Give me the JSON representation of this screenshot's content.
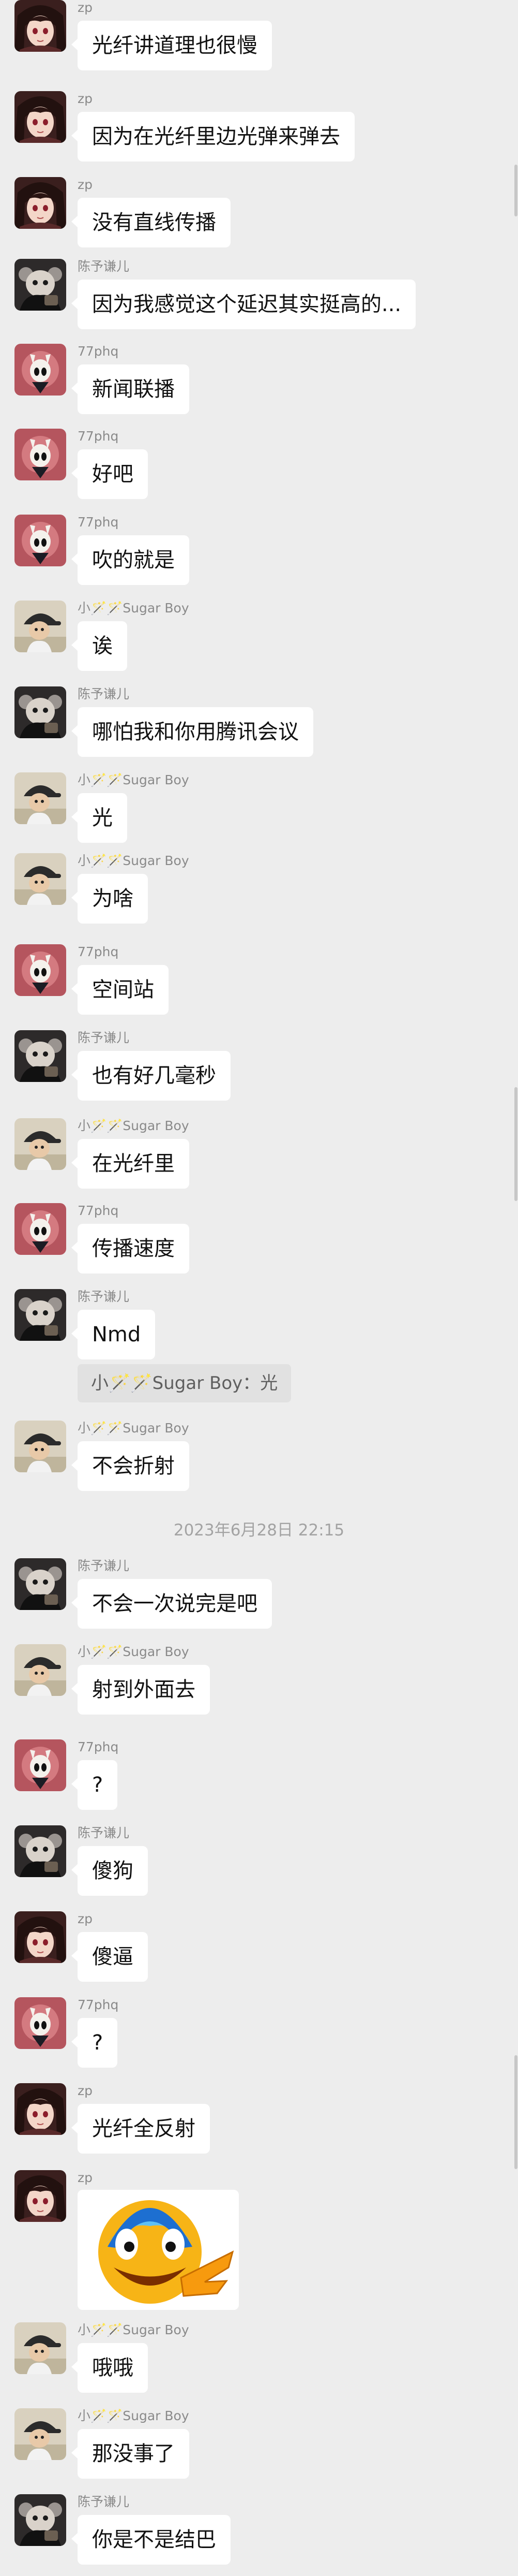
{
  "timestamp": "2023年6月28日 22:15",
  "quote": "小🪄🪄Sugar Boy：光",
  "messages": [
    {
      "sender": "zp",
      "text": "光纤讲道理也很慢"
    },
    {
      "sender": "zp",
      "text": "因为在光纤里边光弹来弹去"
    },
    {
      "sender": "zp",
      "text": "没有直线传播"
    },
    {
      "sender": "陈予谦儿",
      "text": "因为我感觉这个延迟其实挺高的..."
    },
    {
      "sender": "77phq",
      "text": "新闻联播"
    },
    {
      "sender": "77phq",
      "text": "好吧"
    },
    {
      "sender": "77phq",
      "text": "吹的就是"
    },
    {
      "sender": "小🪄🪄Sugar Boy",
      "text": "诶"
    },
    {
      "sender": "陈予谦儿",
      "text": "哪怕我和你用腾讯会议"
    },
    {
      "sender": "小🪄🪄Sugar Boy",
      "text": "光"
    },
    {
      "sender": "小🪄🪄Sugar Boy",
      "text": "为啥"
    },
    {
      "sender": "77phq",
      "text": "空间站"
    },
    {
      "sender": "陈予谦儿",
      "text": "也有好几毫秒"
    },
    {
      "sender": "小🪄🪄Sugar Boy",
      "text": "在光纤里"
    },
    {
      "sender": "77phq",
      "text": "传播速度"
    },
    {
      "sender": "陈予谦儿",
      "text": "Nmd"
    },
    {
      "sender": "小🪄🪄Sugar Boy",
      "text": "不会折射"
    },
    {
      "sender": "陈予谦儿",
      "text": "不会一次说完是吧"
    },
    {
      "sender": "小🪄🪄Sugar Boy",
      "text": "射到外面去"
    },
    {
      "sender": "77phq",
      "text": "?"
    },
    {
      "sender": "陈予谦儿",
      "text": "傻狗"
    },
    {
      "sender": "zp",
      "text": "傻逼"
    },
    {
      "sender": "77phq",
      "text": "?"
    },
    {
      "sender": "zp",
      "text": "光纤全反射"
    },
    {
      "sender": "zp",
      "text": "",
      "sticker": "laughing-emoji-sticker"
    },
    {
      "sender": "小🪄🪄Sugar Boy",
      "text": "哦哦"
    },
    {
      "sender": "小🪄🪄Sugar Boy",
      "text": "那没事了"
    },
    {
      "sender": "陈予谦儿",
      "text": "你是不是结巴"
    }
  ],
  "colors": {
    "background": "#ededed",
    "bubble": "#ffffff",
    "sender_text": "#8a8a8a",
    "quote_bg": "#e1e1e1",
    "timestamp_text": "#a3a3a3"
  },
  "avatars": {
    "zp": "anime-girl-avatar",
    "陈予谦儿": "dark-figure-avatar",
    "77phq": "hollow-knight-avatar",
    "小🪄🪄Sugar Boy": "cap-boy-avatar"
  }
}
